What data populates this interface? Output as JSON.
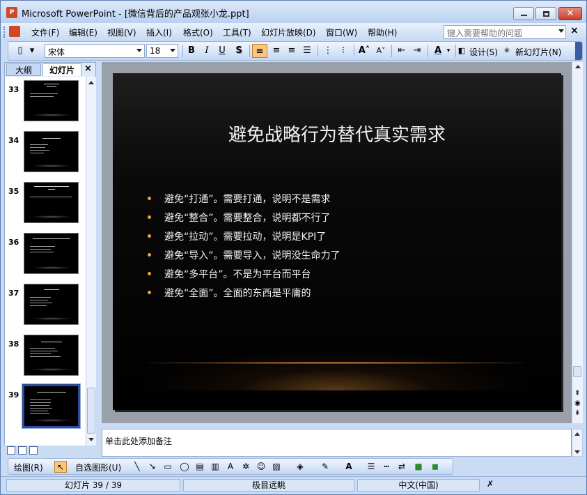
{
  "window": {
    "title": "Microsoft PowerPoint - [微信背后的产品观张小龙.ppt]",
    "app_icon": "powerpoint-icon",
    "close_glyph": "✕"
  },
  "menu": {
    "items": [
      "文件(F)",
      "编辑(E)",
      "视图(V)",
      "插入(I)",
      "格式(O)",
      "工具(T)",
      "幻灯片放映(D)",
      "窗口(W)",
      "帮助(H)"
    ],
    "help_placeholder": "键入需要帮助的问题",
    "close": "×"
  },
  "toolbar": {
    "font_name": "宋体",
    "font_size": "18",
    "bold": "B",
    "italic": "I",
    "underline": "U",
    "shadow": "S",
    "design_label": "设计(S)",
    "new_slide_label": "新幻灯片(N)"
  },
  "panel": {
    "tab_outline": "大纲",
    "tab_slides": "幻灯片",
    "close": "×",
    "thumbnails": [
      {
        "number": "33"
      },
      {
        "number": "34"
      },
      {
        "number": "35"
      },
      {
        "number": "36"
      },
      {
        "number": "37"
      },
      {
        "number": "38"
      },
      {
        "number": "39",
        "selected": true
      }
    ]
  },
  "slide": {
    "title": "避免战略行为替代真实需求",
    "bullets": [
      "避免“打通”。需要打通，说明不是需求",
      "避免“整合”。需要整合，说明都不行了",
      "避免“拉动”。需要拉动，说明是KPI了",
      "避免“导入”。需要导入，说明没生命力了",
      "避免“多平台”。不是为平台而平台",
      "避免“全面”。全面的东西是平庸的"
    ],
    "bullet_color": "#e8a33b"
  },
  "notes": {
    "placeholder": "单击此处添加备注"
  },
  "drawing_toolbar": {
    "draw_label": "绘图(R)",
    "autoshapes_label": "自选图形(U)"
  },
  "status": {
    "slide_position": "幻灯片 39 / 39",
    "design_template": "极目远眺",
    "language": "中文(中国)"
  }
}
